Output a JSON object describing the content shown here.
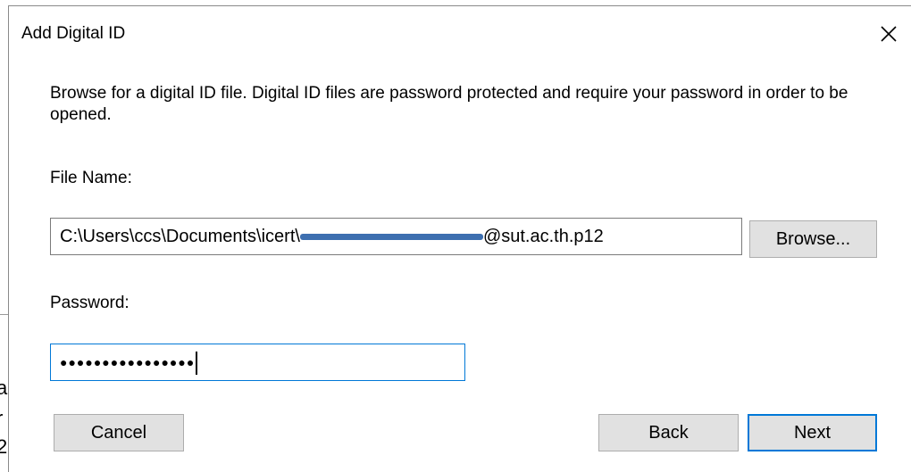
{
  "dialog": {
    "title": "Add Digital ID",
    "description": "Browse for a digital ID file. Digital ID files are password protected and require your password in order to be opened.",
    "file_label": "File Name:",
    "file_value_prefix": "C:\\Users\\ccs\\Documents\\icert\\",
    "file_value_suffix": "@sut.ac.th.p12",
    "browse_label": "Browse...",
    "password_label": "Password:",
    "password_masked": "●●●●●●●●●●●●●●●●",
    "cancel_label": "Cancel",
    "back_label": "Back",
    "next_label": "Next"
  },
  "background": {
    "chars": [
      "a",
      "r",
      "2"
    ]
  },
  "colors": {
    "focus": "#0078d7",
    "button_bg": "#e1e1e1",
    "redaction": "#3d6fb0"
  },
  "icons": {
    "close": "close-icon"
  }
}
